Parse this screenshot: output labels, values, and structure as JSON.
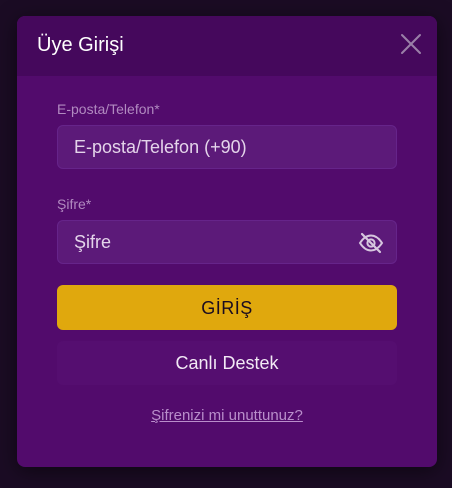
{
  "modal": {
    "title": "Üye Girişi"
  },
  "form": {
    "email_label": "E-posta/Telefon*",
    "email_placeholder": "E-posta/Telefon (+90)",
    "password_label": "Şifre*",
    "password_placeholder": "Şifre",
    "login_button": "GİRİŞ",
    "support_button": "Canlı Destek",
    "forgot_link": "Şifrenizi mi unuttunuz?"
  },
  "icons": {
    "close": "close-icon",
    "password_visibility": "eye-off-icon"
  },
  "colors": {
    "modal_bg": "#520b6c",
    "header_bg": "#45085c",
    "input_bg": "#5c1a79",
    "accent": "#e0a80d"
  }
}
